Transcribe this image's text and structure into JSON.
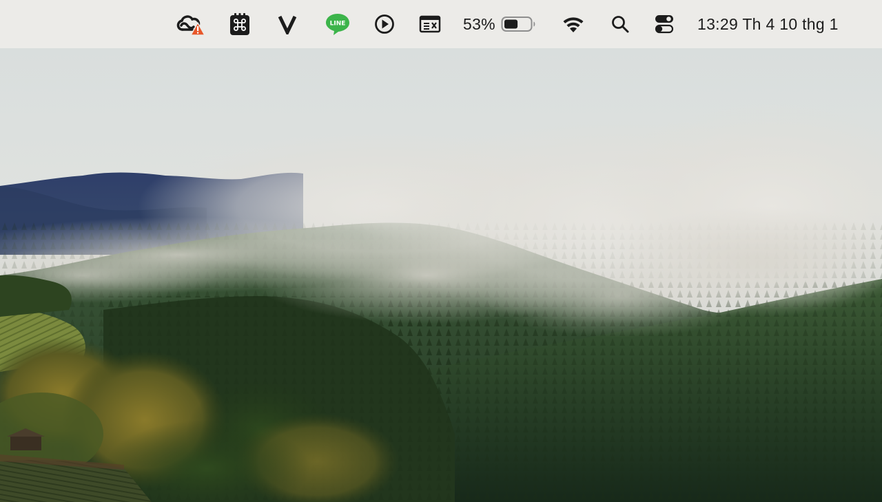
{
  "menubar": {
    "items": [
      {
        "id": "creative-cloud",
        "icon": "creative-cloud-warning-icon"
      },
      {
        "id": "command-app",
        "icon": "command-key-icon"
      },
      {
        "id": "v-app",
        "icon": "v-letter-icon"
      },
      {
        "id": "line-app",
        "icon": "line-app-icon",
        "label": "LINE"
      },
      {
        "id": "media-player",
        "icon": "play-circle-icon"
      },
      {
        "id": "window-app",
        "icon": "window-close-icon"
      },
      {
        "id": "battery",
        "icon": "battery-icon",
        "label": "53%",
        "level": 0.53
      },
      {
        "id": "wifi",
        "icon": "wifi-icon"
      },
      {
        "id": "spotlight",
        "icon": "search-icon"
      },
      {
        "id": "control-center",
        "icon": "control-center-icon"
      }
    ],
    "clock": "13:29 Th 4 10 thg 1"
  },
  "colors": {
    "menubar_bg": "#ecebe8",
    "warning": "#e8572a",
    "line_green": "#3cb44a",
    "icon_dark": "#1c1c1c"
  },
  "wallpaper": {
    "description_icon": "landscape-wallpaper"
  }
}
